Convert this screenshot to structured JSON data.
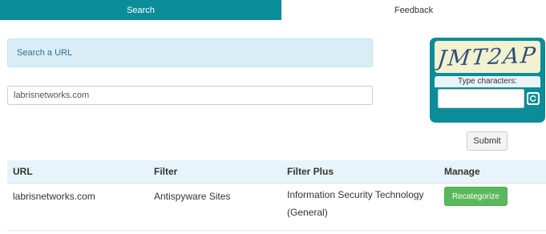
{
  "tabs": [
    {
      "label": "Search",
      "active": true
    },
    {
      "label": "Feedback",
      "active": false
    }
  ],
  "info_box": {
    "text": "Search a URL"
  },
  "url_input": {
    "value": "labrisnetworks.com",
    "placeholder": ""
  },
  "captcha": {
    "image_text": "JMT2AP",
    "label": "Type characters:",
    "input_value": "",
    "refresh_icon": "refresh-icon"
  },
  "submit_label": "Submit",
  "results": {
    "headers": [
      "URL",
      "Filter",
      "Filter Plus",
      "Manage"
    ],
    "rows": [
      {
        "url": "labrisnetworks.com",
        "filter": "Antispyware Sites",
        "filter_plus": "Information Security Technology (General)",
        "action_label": "Recategorize"
      }
    ]
  },
  "colors": {
    "accent": "#0b8c99",
    "info_bg": "#d9edf7",
    "info_text": "#31708f",
    "success": "#5cb85c",
    "table_header_bg": "#e8f4fb"
  }
}
